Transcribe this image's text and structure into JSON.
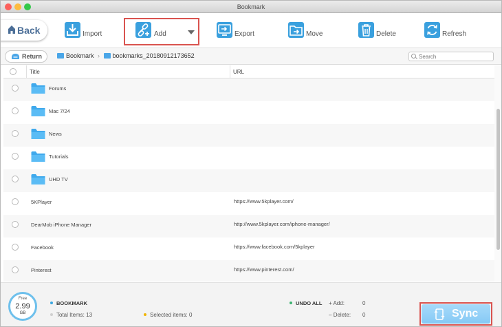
{
  "window": {
    "title": "Bookmark"
  },
  "toolbar": {
    "back_label": "Back",
    "tools": [
      {
        "id": "import",
        "label": "Import",
        "icon": "import-icon"
      },
      {
        "id": "add",
        "label": "Add",
        "icon": "add-link-icon"
      },
      {
        "id": "export",
        "label": "Export",
        "icon": "export-icon"
      },
      {
        "id": "move",
        "label": "Move",
        "icon": "move-icon"
      },
      {
        "id": "delete",
        "label": "Delete",
        "icon": "trash-icon"
      },
      {
        "id": "refresh",
        "label": "Refresh",
        "icon": "refresh-icon"
      }
    ]
  },
  "nav": {
    "return_label": "Return",
    "breadcrumb": [
      "Bookmark",
      "bookmarks_20180912173652"
    ],
    "search_placeholder": "Search"
  },
  "table": {
    "columns": {
      "title": "Title",
      "url": "URL"
    },
    "rows": [
      {
        "type": "folder",
        "title": "Forums",
        "url": ""
      },
      {
        "type": "folder",
        "title": "Mac 7/24",
        "url": ""
      },
      {
        "type": "folder",
        "title": "News",
        "url": ""
      },
      {
        "type": "folder",
        "title": "Tutorials",
        "url": ""
      },
      {
        "type": "folder",
        "title": "UHD TV",
        "url": ""
      },
      {
        "type": "link",
        "title": "5KPlayer",
        "url": "https://www.5kplayer.com/"
      },
      {
        "type": "link",
        "title": "DearMob iPhone Manager",
        "url": "http://www.5kplayer.com/iphone-manager/"
      },
      {
        "type": "link",
        "title": "Facebook",
        "url": "https://www.facebook.com/5kplayer"
      },
      {
        "type": "link",
        "title": "Pinterest",
        "url": "https://www.pinterest.com/"
      }
    ]
  },
  "footer": {
    "free_label": "Free",
    "free_value": "2.99",
    "free_unit": "GB",
    "section_label": "BOOKMARK",
    "total_label": "Total Items:",
    "total_value": "13",
    "selected_label": "Selected items:",
    "selected_value": "0",
    "undo_label": "UNDO ALL",
    "add_label": "Add:",
    "add_value": "0",
    "delete_label": "Delete:",
    "delete_value": "0",
    "sync_label": "Sync"
  },
  "colors": {
    "accent": "#4aa6e8",
    "highlight": "#d9534f",
    "sync": "#86c9f5",
    "section_dot": "#3aa7e0",
    "undo_dot": "#3cb371",
    "selected_dot": "#f0b400"
  }
}
